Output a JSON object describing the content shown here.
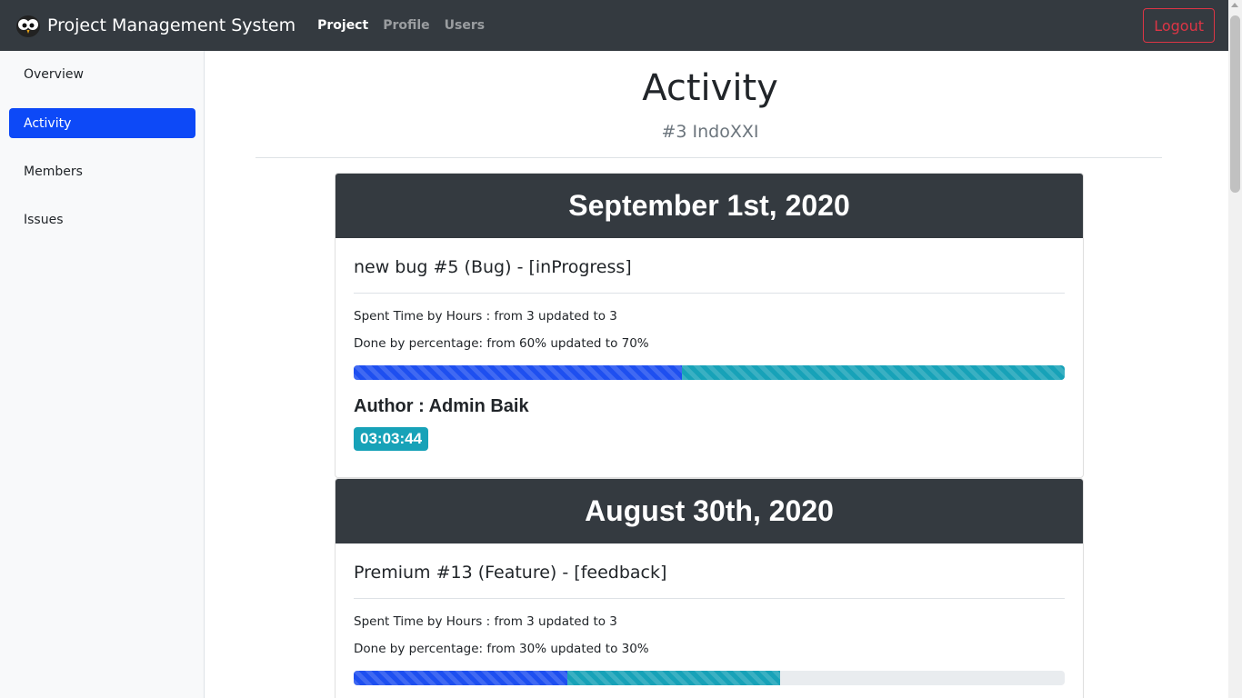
{
  "navbar": {
    "brand": "Project Management System",
    "links": [
      {
        "label": "Project",
        "active": true
      },
      {
        "label": "Profile",
        "active": false
      },
      {
        "label": "Users",
        "active": false
      }
    ],
    "logout_label": "Logout"
  },
  "sidebar": {
    "items": [
      {
        "label": "Overview",
        "active": false
      },
      {
        "label": "Activity",
        "active": true
      },
      {
        "label": "Members",
        "active": false
      },
      {
        "label": "Issues",
        "active": false
      }
    ]
  },
  "page": {
    "title": "Activity",
    "subtitle": "#3 IndoXXI"
  },
  "activities": [
    {
      "date": "September 1st, 2020",
      "title": "new bug #5 (Bug) - [inProgress]",
      "spent_time": "Spent Time by Hours : from 3 updated to 3",
      "done": "Done by percentage: from 60% updated to 70%",
      "progress_percent": [
        46.2,
        53.8
      ],
      "author": "Author : Admin Baik",
      "time": "03:03:44"
    },
    {
      "date": "August 30th, 2020",
      "title": "Premium #13 (Feature) - [feedback]",
      "spent_time": "Spent Time by Hours : from 3 updated to 3",
      "done": "Done by percentage: from 30% updated to 30%",
      "progress_percent": [
        30,
        30
      ]
    }
  ],
  "colors": {
    "navbar_bg": "#343a40",
    "accent": "#0d49f7",
    "danger": "#dc3545",
    "info": "#17a2b8"
  }
}
